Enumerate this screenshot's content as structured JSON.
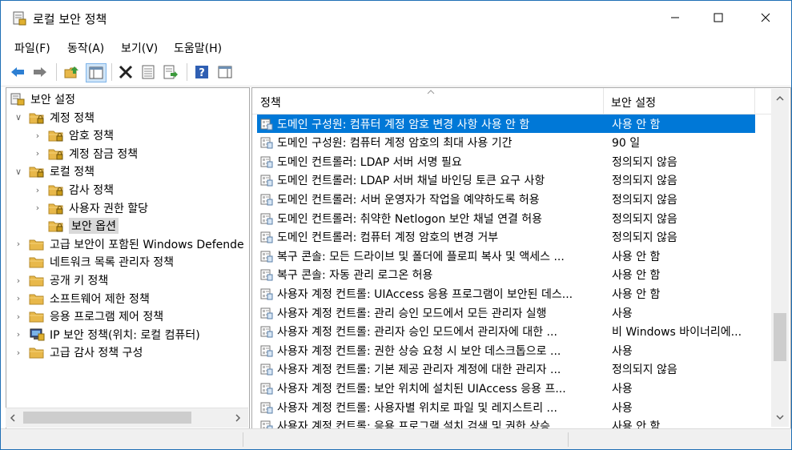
{
  "window": {
    "title": "로컬 보안 정책"
  },
  "menu": [
    "파일(F)",
    "동작(A)",
    "보기(V)",
    "도움말(H)"
  ],
  "toolbar": [
    "back-icon",
    "forward-icon",
    "up-folder-icon",
    "show-hide-tree-icon",
    "delete-icon",
    "properties-icon",
    "export-icon",
    "help-icon",
    "action-pane-icon"
  ],
  "tree": [
    {
      "label": "보안 설정",
      "level": 0,
      "exp": "",
      "icon": "security-settings-icon"
    },
    {
      "label": "계정 정책",
      "level": 1,
      "exp": "v",
      "icon": "folder-lock-icon"
    },
    {
      "label": "암호 정책",
      "level": 2,
      "exp": ">",
      "icon": "folder-lock-icon"
    },
    {
      "label": "계정 잠금 정책",
      "level": 2,
      "exp": ">",
      "icon": "folder-lock-icon"
    },
    {
      "label": "로컬 정책",
      "level": 1,
      "exp": "v",
      "icon": "folder-lock-icon"
    },
    {
      "label": "감사 정책",
      "level": 2,
      "exp": ">",
      "icon": "folder-lock-icon"
    },
    {
      "label": "사용자 권한 할당",
      "level": 2,
      "exp": ">",
      "icon": "folder-lock-icon"
    },
    {
      "label": "보안 옵션",
      "level": 2,
      "exp": "",
      "icon": "folder-lock-icon",
      "selected": true
    },
    {
      "label": "고급 보안이 포함된 Windows Defende",
      "level": 1,
      "exp": ">",
      "icon": "folder-icon"
    },
    {
      "label": "네트워크 목록 관리자 정책",
      "level": 1,
      "exp": "",
      "icon": "folder-icon"
    },
    {
      "label": "공개 키 정책",
      "level": 1,
      "exp": ">",
      "icon": "folder-icon"
    },
    {
      "label": "소프트웨어 제한 정책",
      "level": 1,
      "exp": ">",
      "icon": "folder-icon"
    },
    {
      "label": "응용 프로그램 제어 정책",
      "level": 1,
      "exp": ">",
      "icon": "folder-icon"
    },
    {
      "label": "IP 보안 정책(위치: 로컬 컴퓨터)",
      "level": 1,
      "exp": ">",
      "icon": "ip-security-icon"
    },
    {
      "label": "고급 감사 정책 구성",
      "level": 1,
      "exp": ">",
      "icon": "folder-icon"
    }
  ],
  "columns": {
    "policy": "정책",
    "setting": "보안 설정"
  },
  "rows": [
    {
      "policy": "도메인 구성원: 컴퓨터 계정 암호 변경 사항 사용 안 함",
      "setting": "사용 안 함",
      "selected": true
    },
    {
      "policy": "도메인 구성원: 컴퓨터 계정 암호의 최대 사용 기간",
      "setting": "90 일"
    },
    {
      "policy": "도메인 컨트롤러: LDAP 서버 서명 필요",
      "setting": "정의되지 않음"
    },
    {
      "policy": "도메인 컨트롤러: LDAP 서버 채널 바인딩 토큰 요구 사항",
      "setting": "정의되지 않음"
    },
    {
      "policy": "도메인 컨트롤러: 서버 운영자가 작업을 예약하도록 허용",
      "setting": "정의되지 않음"
    },
    {
      "policy": "도메인 컨트롤러: 취약한 Netlogon 보안 채널 연결 허용",
      "setting": "정의되지 않음"
    },
    {
      "policy": "도메인 컨트롤러: 컴퓨터 계정 암호의 변경 거부",
      "setting": "정의되지 않음"
    },
    {
      "policy": "복구 콘솔: 모든 드라이브 및 폴더에 플로피 복사 및 액세스 ...",
      "setting": "사용 안 함"
    },
    {
      "policy": "복구 콘솔: 자동 관리 로그온 허용",
      "setting": "사용 안 함"
    },
    {
      "policy": "사용자 계정 컨트롤: UIAccess 응용 프로그램이 보안된 데스...",
      "setting": "사용 안 함"
    },
    {
      "policy": "사용자 계정 컨트롤: 관리 승인 모드에서 모든 관리자 실행",
      "setting": "사용"
    },
    {
      "policy": "사용자 계정 컨트롤: 관리자 승인 모드에서 관리자에 대한 ...",
      "setting": "비 Windows 바이너리에..."
    },
    {
      "policy": "사용자 계정 컨트롤: 권한 상승 요청 시 보안 데스크톱으로 ...",
      "setting": "사용"
    },
    {
      "policy": "사용자 계정 컨트롤: 기본 제공 관리자 계정에 대한 관리자 ...",
      "setting": "정의되지 않음"
    },
    {
      "policy": "사용자 계정 컨트롤: 보안 위치에 설치된 UIAccess 응용 프...",
      "setting": "사용"
    },
    {
      "policy": "사용자 계정 컨트롤: 사용자별 위치로 파일 및 레지스트리 ...",
      "setting": "사용"
    },
    {
      "policy": "사용자 계정 컨트롤: 응용 프로그램 설치 검색 및 권한 상승...",
      "setting": "사용 안 함"
    }
  ],
  "colors": {
    "selection": "#0078d7",
    "folder": "#e8b84a",
    "border": "#a8a8a8"
  }
}
